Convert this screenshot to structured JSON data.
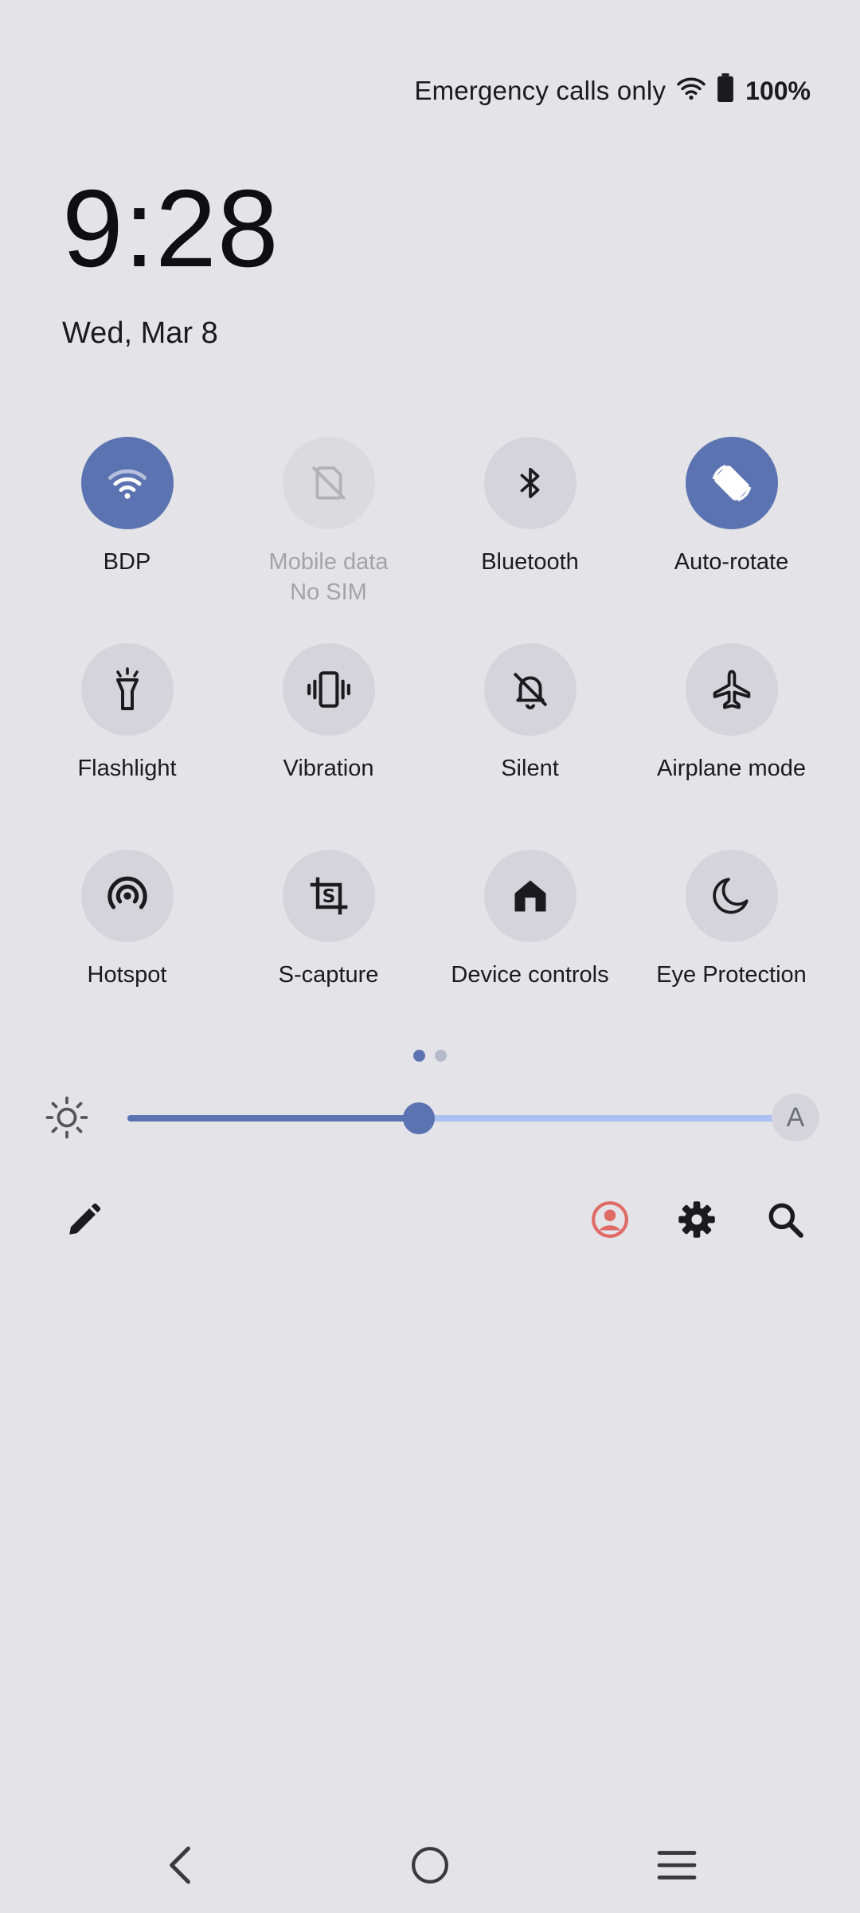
{
  "status": {
    "carrier": "Emergency calls only",
    "battery_percent": "100%",
    "icons": [
      "wifi-signal-icon",
      "battery-icon"
    ]
  },
  "clock": {
    "time": "9:28",
    "date": "Wed, Mar 8"
  },
  "tiles": [
    {
      "label": "BDP",
      "sub": "",
      "state": "active",
      "icon": "wifi-icon"
    },
    {
      "label": "Mobile data",
      "sub": "No SIM",
      "state": "disabled",
      "icon": "no-sim-icon"
    },
    {
      "label": "Bluetooth",
      "sub": "",
      "state": "inactive",
      "icon": "bluetooth-icon"
    },
    {
      "label": "Auto-rotate",
      "sub": "",
      "state": "active",
      "icon": "auto-rotate-icon"
    },
    {
      "label": "Flashlight",
      "sub": "",
      "state": "inactive",
      "icon": "flashlight-icon"
    },
    {
      "label": "Vibration",
      "sub": "",
      "state": "inactive",
      "icon": "vibration-icon"
    },
    {
      "label": "Silent",
      "sub": "",
      "state": "inactive",
      "icon": "silent-bell-icon"
    },
    {
      "label": "Airplane mode",
      "sub": "",
      "state": "inactive",
      "icon": "airplane-icon"
    },
    {
      "label": "Hotspot",
      "sub": "",
      "state": "inactive",
      "icon": "hotspot-icon"
    },
    {
      "label": "S-capture",
      "sub": "",
      "state": "inactive",
      "icon": "screenshot-crop-icon"
    },
    {
      "label": "Device controls",
      "sub": "",
      "state": "inactive",
      "icon": "home-icon"
    },
    {
      "label": "Eye Protection",
      "sub": "",
      "state": "inactive",
      "icon": "moon-icon"
    }
  ],
  "pager": {
    "pages": 2,
    "current": 1
  },
  "brightness": {
    "level": 0.45,
    "auto_label": "A"
  },
  "toolbar": {
    "icons": [
      "edit-pencil-icon",
      "user-account-icon",
      "settings-gear-icon",
      "search-icon"
    ]
  },
  "colors": {
    "accent": "#5b73b1",
    "track": "#a9c1f3",
    "background": "#e3e3e8",
    "tile": "#d4d4da",
    "user": "#e06b66"
  },
  "navbar": {
    "icons": [
      "back-icon",
      "home-circle-icon",
      "recents-menu-icon"
    ]
  }
}
